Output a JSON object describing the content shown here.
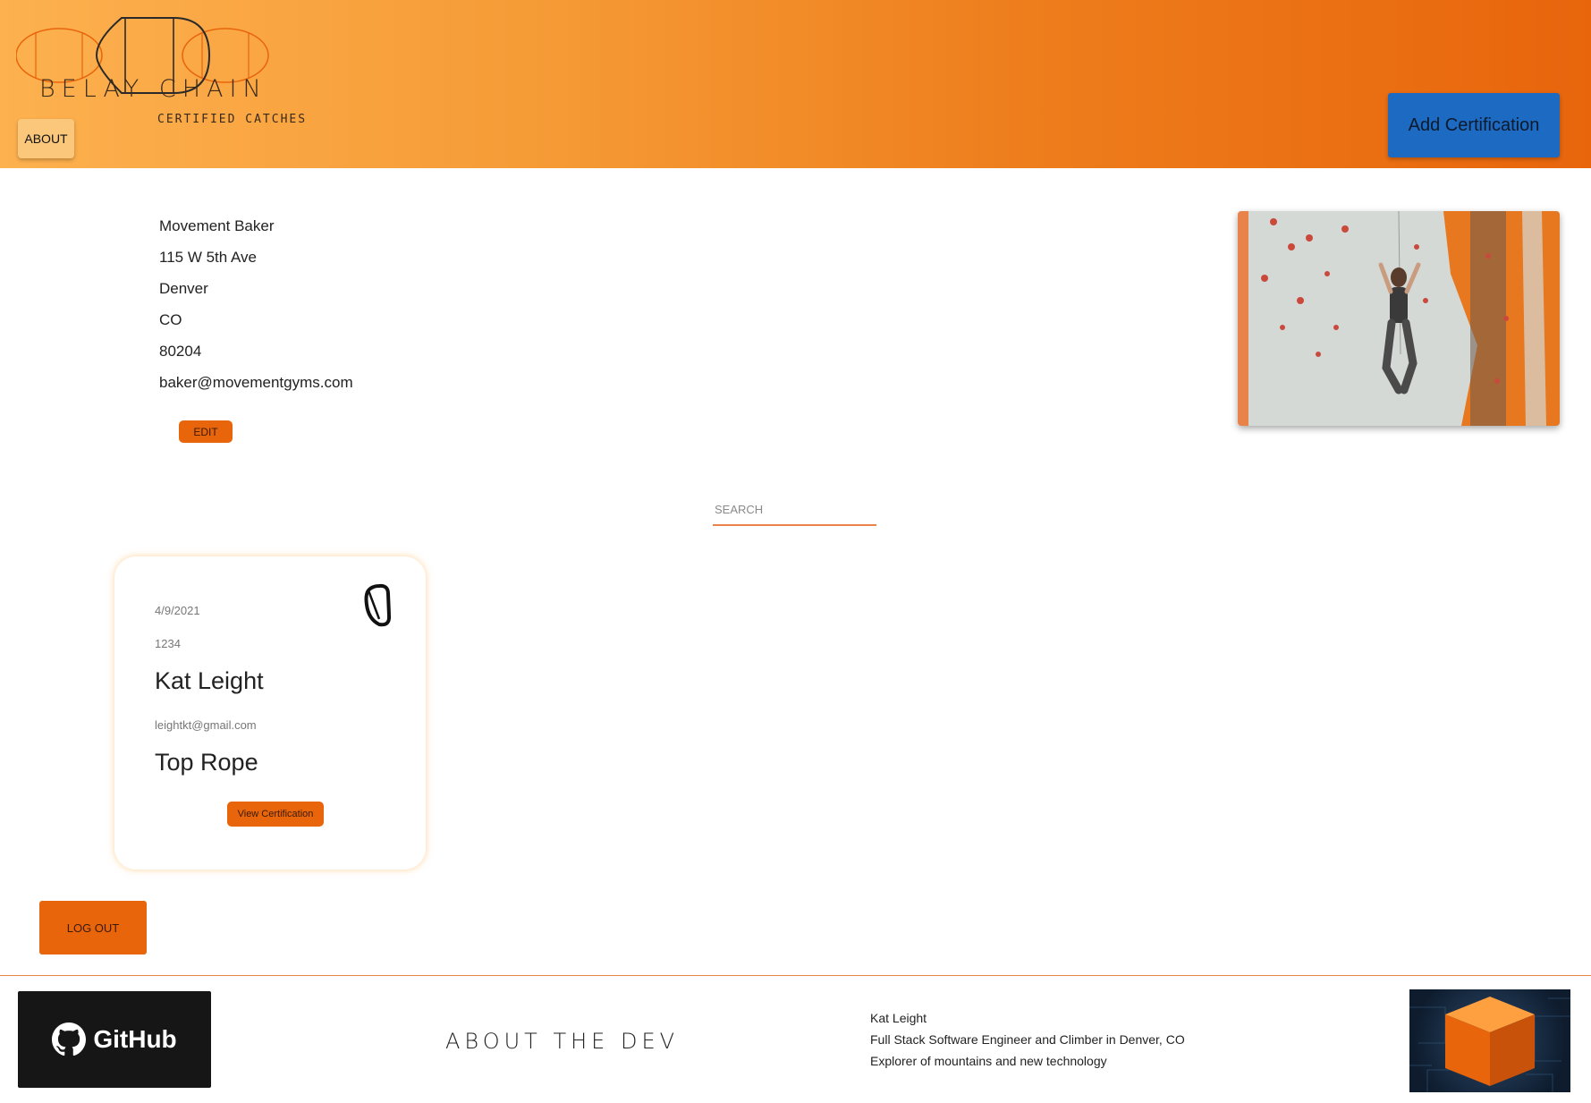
{
  "header": {
    "logo_title": "BELAY CHAIN",
    "logo_subtitle": "CERTIFIED CATCHES",
    "about_label": "ABOUT",
    "add_certification_label": "Add Certification"
  },
  "gym": {
    "name": "Movement Baker",
    "street": "115 W 5th Ave",
    "city": "Denver",
    "state": "CO",
    "zip": "80204",
    "email": "baker@movementgyms.com",
    "edit_label": "EDIT"
  },
  "search": {
    "placeholder": "SEARCH",
    "value": ""
  },
  "certifications": [
    {
      "date": "4/9/2021",
      "number": "1234",
      "climber_name": "Kat Leight",
      "climber_email": "leightkt@gmail.com",
      "type": "Top Rope",
      "view_label": "View Certification",
      "icon": "carabiner-icon"
    }
  ],
  "logout_label": "LOG OUT",
  "footer": {
    "github_label": "GitHub",
    "about_dev_label": "ABOUT THE DEV",
    "dev_name": "Kat Leight",
    "dev_role": "Full Stack Software Engineer and Climber in Denver, CO",
    "dev_tagline": "Explorer of mountains and new technology"
  },
  "colors": {
    "header_gradient_start": "#fdb14f",
    "header_gradient_end": "#e8650c",
    "accent_orange": "#e8650c",
    "add_button_blue": "#1d6ac2",
    "github_black": "#161616"
  }
}
